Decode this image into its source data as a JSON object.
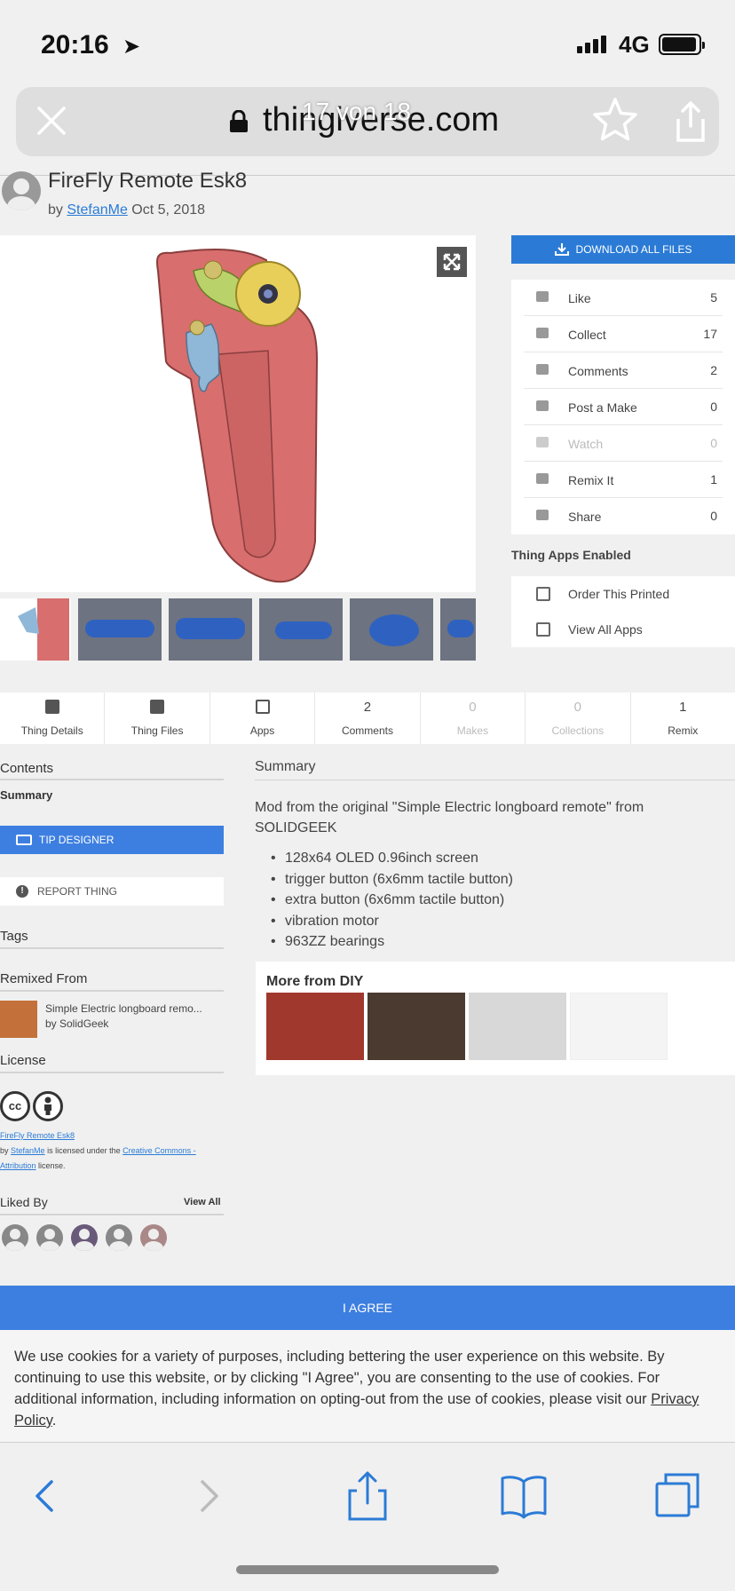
{
  "status_bar": {
    "time": "20:16",
    "network": "4G"
  },
  "url_bar": {
    "domain": "thingiverse.com",
    "page_count": "17 von 18"
  },
  "thing": {
    "title": "FireFly Remote Esk8",
    "by_prefix": "by",
    "author": "StefanMe",
    "date": "Oct 5, 2018"
  },
  "sidebar": {
    "download_label": "DOWNLOAD ALL FILES",
    "stats": [
      {
        "label": "Like",
        "count": "5"
      },
      {
        "label": "Collect",
        "count": "17"
      },
      {
        "label": "Comments",
        "count": "2"
      },
      {
        "label": "Post a Make",
        "count": "0"
      },
      {
        "label": "Watch",
        "count": "0"
      },
      {
        "label": "Remix It",
        "count": "1"
      },
      {
        "label": "Share",
        "count": "0"
      }
    ],
    "apps_title": "Thing Apps Enabled",
    "apps": [
      {
        "label": "Order This Printed"
      },
      {
        "label": "View All Apps"
      }
    ]
  },
  "tabs": [
    {
      "top": "",
      "label": "Thing Details"
    },
    {
      "top": "",
      "label": "Thing Files"
    },
    {
      "top": "",
      "label": "Apps"
    },
    {
      "top": "2",
      "label": "Comments"
    },
    {
      "top": "0",
      "label": "Makes"
    },
    {
      "top": "0",
      "label": "Collections"
    },
    {
      "top": "1",
      "label": "Remix"
    }
  ],
  "left_col": {
    "contents_title": "Contents",
    "summary_link": "Summary",
    "tip_label": "TIP DESIGNER",
    "report_label": "REPORT THING",
    "tags_title": "Tags",
    "remixed_title": "Remixed From",
    "remix_name": "Simple Electric longboard remo...",
    "remix_by": "by SolidGeek",
    "license_title": "License",
    "license_icon_cc": "cc",
    "license_thing": "FireFly Remote Esk8",
    "license_by": "by",
    "license_author": "StefanMe",
    "license_mid": "is licensed under the",
    "license_link": "Creative Commons - Attribution",
    "license_end": "license.",
    "liked_title": "Liked By",
    "view_all": "View All"
  },
  "summary": {
    "title": "Summary",
    "description": "Mod from the original \"Simple Electric longboard remote\" from SOLIDGEEK",
    "bullets": [
      "128x64 OLED 0.96inch screen",
      "trigger button (6x6mm tactile button)",
      "extra button (6x6mm tactile button)",
      "vibration motor",
      "963ZZ bearings"
    ],
    "more_title": "More from DIY"
  },
  "cookie": {
    "agree_label": "I AGREE",
    "text": "We use cookies for a variety of purposes, including bettering the user experience on this website. By continuing to use this website, or by clicking \"I Agree\", you are consenting to the use of cookies. For additional information, including information on opting-out from the use of cookies, please visit our",
    "policy_link": "Privacy Policy",
    "period": "."
  },
  "colors": {
    "accent": "#3d7fe0",
    "link": "#2b7bd6",
    "remote_body": "#d86e6e",
    "trigger": "#8fb8d8",
    "gear": "#e8cf5a"
  },
  "icons": {
    "urlbar": [
      "close-icon",
      "lock-icon",
      "star-icon",
      "reload-icon"
    ],
    "toolbar": [
      "back-icon",
      "forward-icon",
      "share-icon",
      "bookmarks-icon",
      "tabs-icon"
    ]
  }
}
